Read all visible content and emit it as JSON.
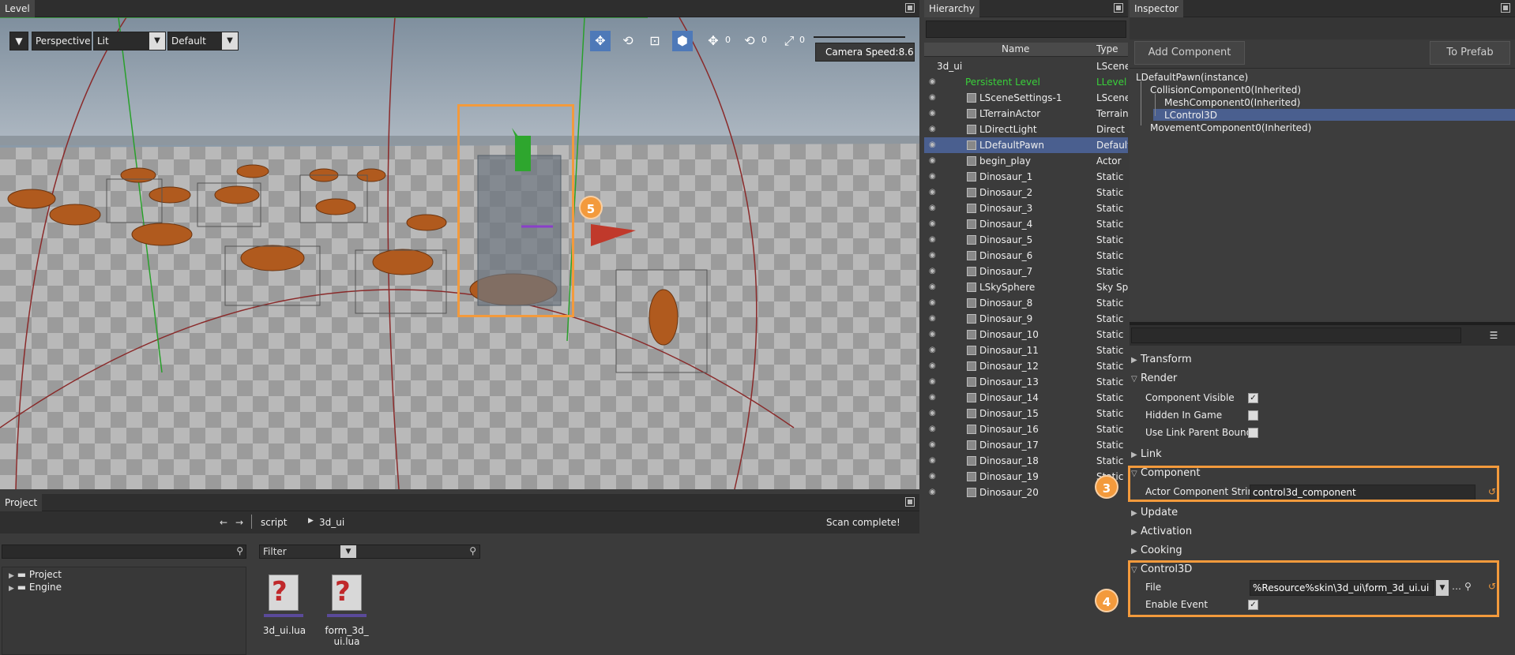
{
  "level": {
    "tab": "Level",
    "projection": "Perspective",
    "view_mode": "Lit",
    "preset": "Default",
    "camera_speed": "Camera Speed:8.6",
    "snap_values": [
      "0",
      "0",
      "0"
    ],
    "callout": "5"
  },
  "project": {
    "tab": "Project",
    "breadcrumb": [
      "script",
      "3d_ui"
    ],
    "status": "Scan complete!",
    "filter_placeholder": "Filter",
    "tree": [
      "Project",
      "Engine"
    ],
    "files": [
      "3d_ui.lua",
      "form_3d_\nui.lua"
    ]
  },
  "hierarchy": {
    "tab": "Hierarchy",
    "col_name": "Name",
    "col_type": "Type",
    "rows": [
      {
        "name": "3d_ui",
        "type": "LScene"
      },
      {
        "name": "Persistent Level",
        "type": "LLevel"
      },
      {
        "name": "LSceneSettings-1",
        "type": "LScene"
      },
      {
        "name": "LTerrainActor",
        "type": "Terrain"
      },
      {
        "name": "LDirectLight",
        "type": "Direct"
      },
      {
        "name": "LDefaultPawn",
        "type": "Default"
      },
      {
        "name": "begin_play",
        "type": "Actor"
      },
      {
        "name": "Dinosaur_1",
        "type": "Static"
      },
      {
        "name": "Dinosaur_2",
        "type": "Static"
      },
      {
        "name": "Dinosaur_3",
        "type": "Static"
      },
      {
        "name": "Dinosaur_4",
        "type": "Static"
      },
      {
        "name": "Dinosaur_5",
        "type": "Static"
      },
      {
        "name": "Dinosaur_6",
        "type": "Static"
      },
      {
        "name": "Dinosaur_7",
        "type": "Static"
      },
      {
        "name": "LSkySphere",
        "type": "Sky Sp"
      },
      {
        "name": "Dinosaur_8",
        "type": "Static"
      },
      {
        "name": "Dinosaur_9",
        "type": "Static"
      },
      {
        "name": "Dinosaur_10",
        "type": "Static"
      },
      {
        "name": "Dinosaur_11",
        "type": "Static"
      },
      {
        "name": "Dinosaur_12",
        "type": "Static"
      },
      {
        "name": "Dinosaur_13",
        "type": "Static"
      },
      {
        "name": "Dinosaur_14",
        "type": "Static"
      },
      {
        "name": "Dinosaur_15",
        "type": "Static"
      },
      {
        "name": "Dinosaur_16",
        "type": "Static"
      },
      {
        "name": "Dinosaur_17",
        "type": "Static"
      },
      {
        "name": "Dinosaur_18",
        "type": "Static"
      },
      {
        "name": "Dinosaur_19",
        "type": "Static"
      },
      {
        "name": "Dinosaur_20",
        "type": ""
      }
    ]
  },
  "inspector": {
    "tab": "Inspector",
    "add_component": "Add Component",
    "to_prefab": "To Prefab",
    "tree": [
      "LDefaultPawn(instance)",
      "CollisionComponent0(Inherited)",
      "MeshComponent0(Inherited)",
      "LControl3D",
      "MovementComponent0(Inherited)"
    ],
    "sections": {
      "transform": "Transform",
      "render": "Render",
      "link": "Link",
      "component": "Component",
      "update": "Update",
      "activation": "Activation",
      "cooking": "Cooking",
      "control3d": "Control3D"
    },
    "render_props": {
      "component_visible": "Component Visible",
      "hidden_in_game": "Hidden In Game",
      "use_link_parent_bound": "Use Link Parent Bound"
    },
    "component_props": {
      "label": "Actor Component Strin",
      "value": "control3d_component"
    },
    "control3d_props": {
      "file_label": "File",
      "file_value": "%Resource%skin\\3d_ui\\form_3d_ui.ui",
      "enable_event_label": "Enable Event"
    },
    "callout_component": "3",
    "callout_control3d": "4"
  },
  "colors": {
    "accent": "#f39a3c",
    "selection": "#4a5f8f",
    "persistent_level": "#39d13a"
  }
}
